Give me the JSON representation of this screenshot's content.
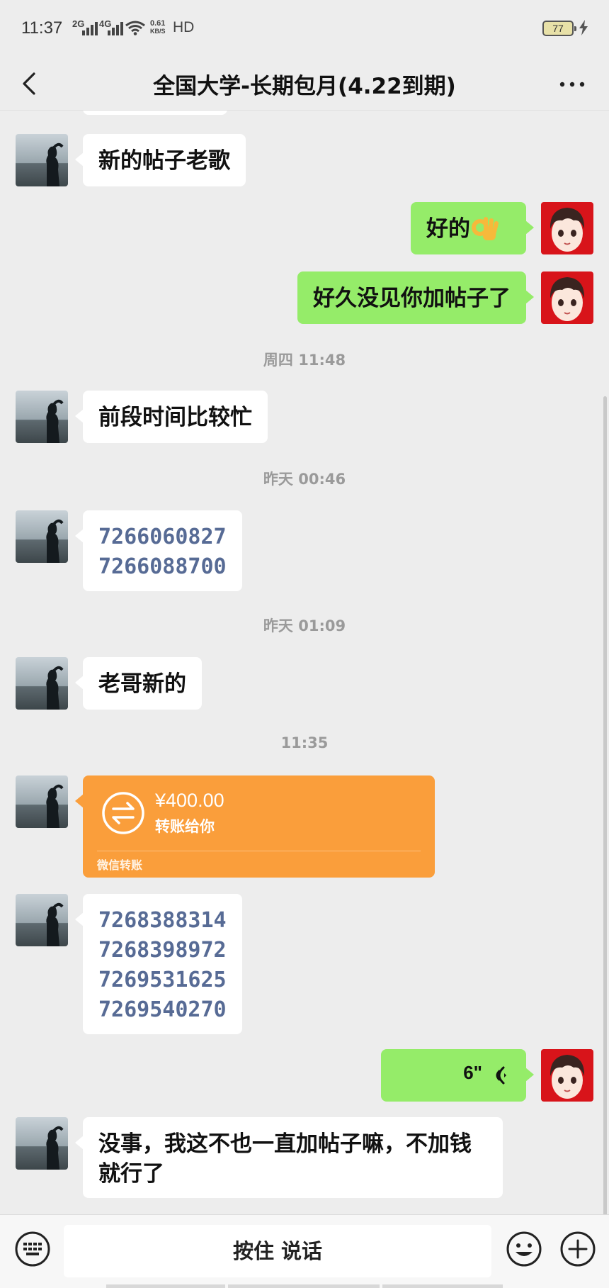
{
  "status_bar": {
    "time": "11:37",
    "signal1_label": "2G",
    "signal2_label": "4G",
    "net_speed_value": "0.61",
    "net_speed_unit": "KB/S",
    "hd_label": "HD",
    "battery_level": "77"
  },
  "header": {
    "title": "全国大学-长期包月(4.22到期)"
  },
  "messages": {
    "m1": "新的帖子老歌",
    "m2": "好的",
    "m3": "好久没见你加帖子了",
    "t1": "周四 11:48",
    "m4": "前段时间比较忙",
    "t2": "昨天 00:46",
    "m5": [
      "7266060827",
      "7266088700"
    ],
    "t3": "昨天 01:09",
    "m6": "老哥新的",
    "t4": "11:35",
    "transfer": {
      "amount": "¥400.00",
      "subtitle": "转账给你",
      "footer": "微信转账"
    },
    "m7": [
      "7268388314",
      "7268398972",
      "7269531625",
      "7269540270"
    ],
    "voice_duration": "6\"",
    "m8": "没事，我这不也一直加帖子嘛，不加钱就行了"
  },
  "input_bar": {
    "hold_to_talk": "按住 说话"
  },
  "colors": {
    "background": "#ededed",
    "incoming_bubble": "#ffffff",
    "outgoing_bubble": "#95ec69",
    "transfer_card": "#fa9e3b",
    "number_text": "#576b95"
  },
  "icons": [
    "back-arrow-icon",
    "more-icon",
    "ok-hand-emoji",
    "transfer-icon",
    "voice-wave-icon",
    "keyboard-icon",
    "emoji-icon",
    "plus-icon"
  ]
}
